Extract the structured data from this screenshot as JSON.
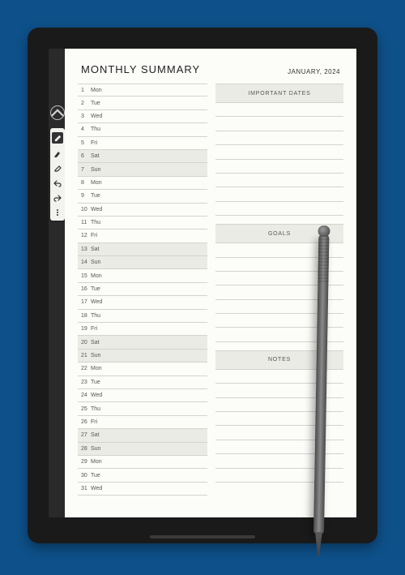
{
  "header": {
    "title": "MONTHLY SUMMARY",
    "month": "JANUARY, 2024"
  },
  "days": [
    {
      "num": "1",
      "dow": "Mon",
      "we": false
    },
    {
      "num": "2",
      "dow": "Tue",
      "we": false
    },
    {
      "num": "3",
      "dow": "Wed",
      "we": false
    },
    {
      "num": "4",
      "dow": "Thu",
      "we": false
    },
    {
      "num": "5",
      "dow": "Fri",
      "we": false
    },
    {
      "num": "6",
      "dow": "Sat",
      "we": true
    },
    {
      "num": "7",
      "dow": "Sun",
      "we": true
    },
    {
      "num": "8",
      "dow": "Mon",
      "we": false
    },
    {
      "num": "9",
      "dow": "Tue",
      "we": false
    },
    {
      "num": "10",
      "dow": "Wed",
      "we": false
    },
    {
      "num": "11",
      "dow": "Thu",
      "we": false
    },
    {
      "num": "12",
      "dow": "Fri",
      "we": false
    },
    {
      "num": "13",
      "dow": "Sat",
      "we": true
    },
    {
      "num": "14",
      "dow": "Sun",
      "we": true
    },
    {
      "num": "15",
      "dow": "Mon",
      "we": false
    },
    {
      "num": "16",
      "dow": "Tue",
      "we": false
    },
    {
      "num": "17",
      "dow": "Wed",
      "we": false
    },
    {
      "num": "18",
      "dow": "Thu",
      "we": false
    },
    {
      "num": "19",
      "dow": "Fri",
      "we": false
    },
    {
      "num": "20",
      "dow": "Sat",
      "we": true
    },
    {
      "num": "21",
      "dow": "Sun",
      "we": true
    },
    {
      "num": "22",
      "dow": "Mon",
      "we": false
    },
    {
      "num": "23",
      "dow": "Tue",
      "we": false
    },
    {
      "num": "24",
      "dow": "Wed",
      "we": false
    },
    {
      "num": "25",
      "dow": "Thu",
      "we": false
    },
    {
      "num": "26",
      "dow": "Fri",
      "we": false
    },
    {
      "num": "27",
      "dow": "Sat",
      "we": true
    },
    {
      "num": "28",
      "dow": "Sun",
      "we": true
    },
    {
      "num": "29",
      "dow": "Mon",
      "we": false
    },
    {
      "num": "30",
      "dow": "Tue",
      "we": false
    },
    {
      "num": "31",
      "dow": "Wed",
      "we": false
    }
  ],
  "panels": {
    "important": {
      "title": "IMPORTANT DATES",
      "lines": 8
    },
    "goals": {
      "title": "GOALS",
      "lines": 7
    },
    "notes": {
      "title": "NOTES",
      "lines": 8
    }
  },
  "toolbar": {
    "tools": [
      "pen",
      "highlighter",
      "eraser",
      "undo",
      "redo",
      "more"
    ],
    "selected": 0
  }
}
